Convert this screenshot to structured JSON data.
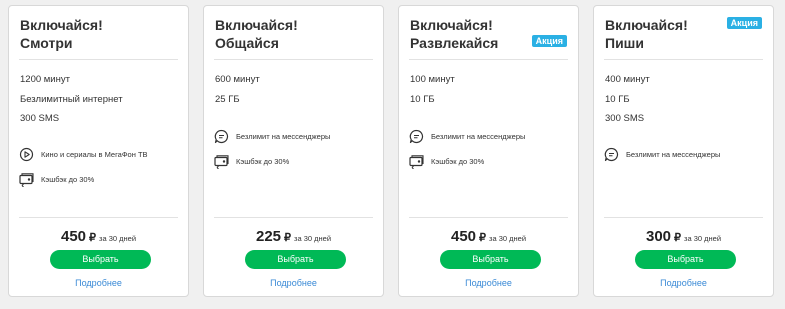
{
  "colors": {
    "accent_green": "#00b956",
    "badge_blue": "#2ab0e4",
    "link_blue": "#3a8ad6",
    "background": "#f0f0f0"
  },
  "tariffs": [
    {
      "title_line1": "Включайся!",
      "title_line2": "Смотри",
      "badge": "",
      "specs": [
        "1200 минут",
        "Безлимитный интернет",
        "300 SMS"
      ],
      "features": [
        {
          "icon": "play-icon",
          "text": "Кино и сериалы в МегаФон ТВ"
        },
        {
          "icon": "cashback-icon",
          "text": "Кэшбэк до 30%"
        }
      ],
      "price": "450",
      "currency": "₽",
      "period": "за 30 дней",
      "button_label": "Выбрать",
      "more_label": "Подробнее"
    },
    {
      "title_line1": "Включайся!",
      "title_line2": "Общайся",
      "badge": "",
      "specs": [
        "600 минут",
        "25 ГБ"
      ],
      "features": [
        {
          "icon": "chat-icon",
          "text": "Безлимит на мессенджеры"
        },
        {
          "icon": "cashback-icon",
          "text": "Кэшбэк до 30%"
        }
      ],
      "price": "225",
      "currency": "₽",
      "period": "за 30 дней",
      "button_label": "Выбрать",
      "more_label": "Подробнее"
    },
    {
      "title_line1": "Включайся!",
      "title_line2": "Развлекайся",
      "badge": "Акция",
      "specs": [
        "100 минут",
        "10 ГБ"
      ],
      "features": [
        {
          "icon": "chat-icon",
          "text": "Безлимит на мессенджеры"
        },
        {
          "icon": "cashback-icon",
          "text": "Кэшбэк до 30%"
        }
      ],
      "price": "450",
      "currency": "₽",
      "period": "за 30 дней",
      "button_label": "Выбрать",
      "more_label": "Подробнее"
    },
    {
      "title_line1": "Включайся!",
      "title_line2": "Пиши",
      "badge": "Акция",
      "specs": [
        "400 минут",
        "10 ГБ",
        "300 SMS"
      ],
      "features": [
        {
          "icon": "chat-icon",
          "text": "Безлимит на мессенджеры"
        }
      ],
      "price": "300",
      "currency": "₽",
      "period": "за 30 дней",
      "button_label": "Выбрать",
      "more_label": "Подробнее"
    }
  ]
}
